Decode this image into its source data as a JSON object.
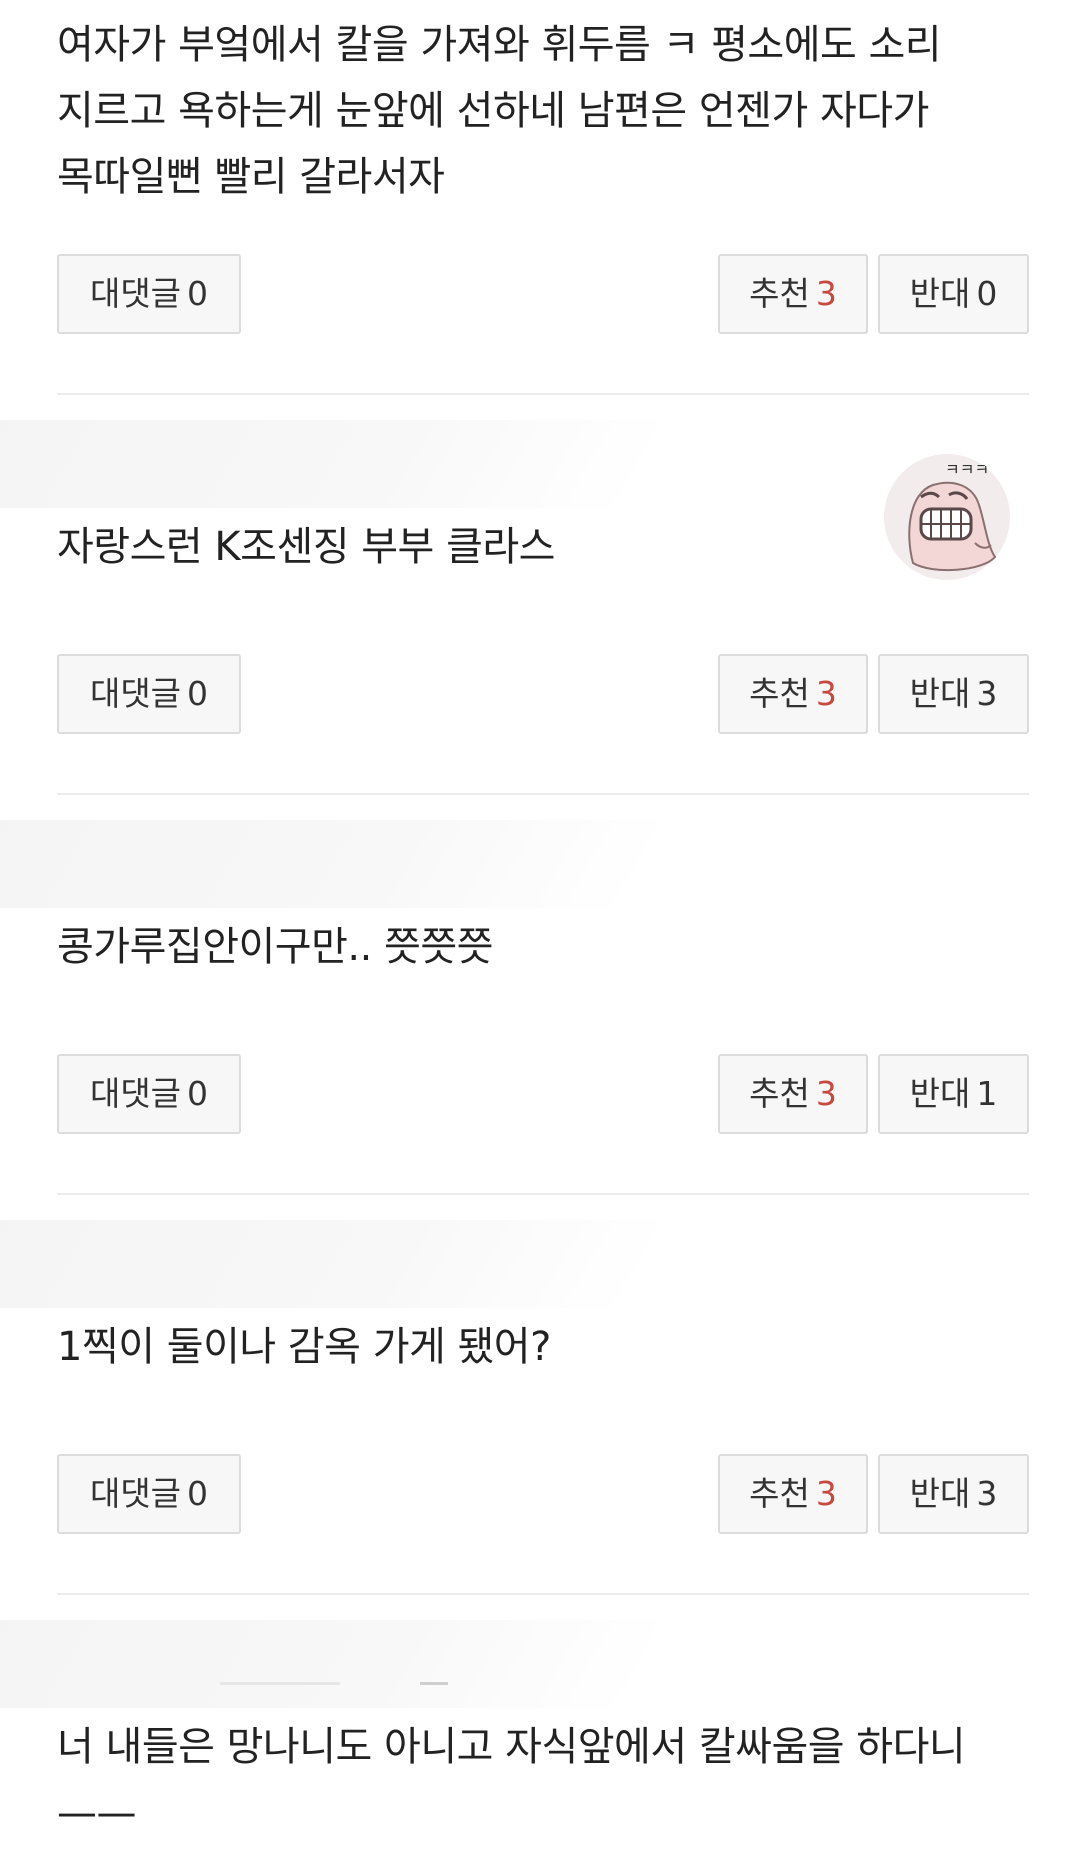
{
  "comments": [
    {
      "text": "여자가 부엌에서 칼을 가져와 휘두름 ㅋ 평소에도 소리 지르고 욕하는게 눈앞에 선하네 남편은 언젠가 자다가 목따일뻔 빨리 갈라서자",
      "reply_label": "대댓글",
      "reply_count": "0",
      "like_label": "추천",
      "like_count": "3",
      "dislike_label": "반대",
      "dislike_count": "0"
    },
    {
      "text": "자랑스런 K조센징 부부 클라스",
      "reply_label": "대댓글",
      "reply_count": "0",
      "like_label": "추천",
      "like_count": "3",
      "dislike_label": "반대",
      "dislike_count": "3",
      "sticker_text": "ㅋㅋㅋ"
    },
    {
      "text": "콩가루집안이구만.. 쯧쯧쯧",
      "reply_label": "대댓글",
      "reply_count": "0",
      "like_label": "추천",
      "like_count": "3",
      "dislike_label": "반대",
      "dislike_count": "1"
    },
    {
      "text": "1찍이 둘이나 감옥 가게 됐어?",
      "reply_label": "대댓글",
      "reply_count": "0",
      "like_label": "추천",
      "like_count": "3",
      "dislike_label": "반대",
      "dislike_count": "3"
    },
    {
      "text": "너 내들은 망나니도 아니고 자식앞에서 칼싸움을 하다니——"
    }
  ],
  "colors": {
    "like_count": "#c8473e",
    "button_bg": "#f7f7f7",
    "button_border": "#dcdcdc",
    "divider": "#ececec"
  },
  "icons": {
    "sticker": "laughing-pink-creature-sticker"
  }
}
